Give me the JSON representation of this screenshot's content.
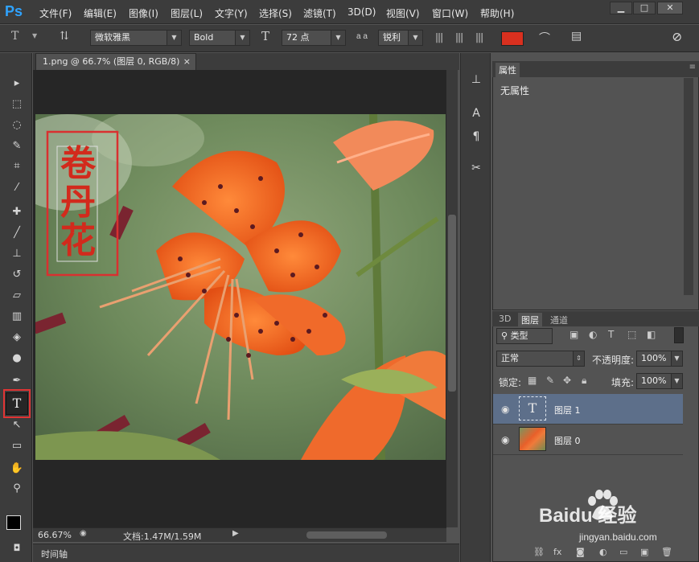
{
  "app": {
    "logo": "Ps"
  },
  "menu": [
    "文件(F)",
    "编辑(E)",
    "图像(I)",
    "图层(L)",
    "文字(Y)",
    "选择(S)",
    "滤镜(T)",
    "3D(D)",
    "视图(V)",
    "窗口(W)",
    "帮助(H)"
  ],
  "window_controls": {
    "minimize": "▁",
    "maximize": "□",
    "close": "✕"
  },
  "options": {
    "tool_icon": "T",
    "font_family": "微软雅黑",
    "font_style": "Bold",
    "font_size": "72 点",
    "aa_label": "a a",
    "antialias": "锐利",
    "color": "#d9301f"
  },
  "document": {
    "tab_title": "1.png @ 66.7% (图层 0, RGB/8)",
    "tab_close": "×",
    "text_layer": [
      "卷",
      "丹",
      "花"
    ],
    "zoom": "66.67%",
    "doc_info": "文档:1.47M/1.59M"
  },
  "timeline": {
    "label": "时间轴"
  },
  "properties": {
    "tab": "属性",
    "content": "无属性"
  },
  "layers_panel": {
    "tabs": [
      "3D",
      "图层",
      "通道"
    ],
    "kind_filter": "类型",
    "blend_mode": "正常",
    "opacity_label": "不透明度:",
    "opacity": "100%",
    "lock_label": "锁定:",
    "fill_label": "填充:",
    "fill": "100%",
    "layers": [
      {
        "name": "图层 1",
        "thumb_text": "T",
        "selected": true
      },
      {
        "name": "图层 0",
        "selected": false
      }
    ]
  },
  "watermark": {
    "brand": "Baidu 经验",
    "url": "jingyan.baidu.com"
  }
}
